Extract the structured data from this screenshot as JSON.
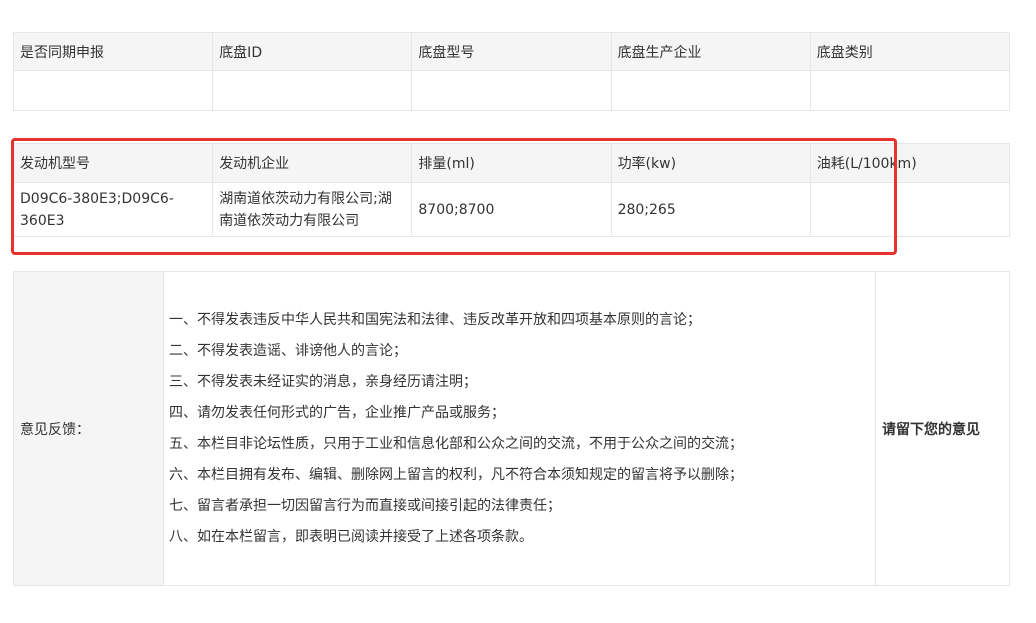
{
  "chassis": {
    "headers": [
      "是否同期申报",
      "底盘ID",
      "底盘型号",
      "底盘生产企业",
      "底盘类别"
    ],
    "values": [
      "",
      "",
      "",
      "",
      ""
    ]
  },
  "engine": {
    "headers": [
      "发动机型号",
      "发动机企业",
      "排量(ml)",
      "功率(kw)",
      "油耗(L/100km)"
    ],
    "values": [
      "D09C6-380E3;D09C6-360E3",
      "湖南道依茨动力有限公司;湖南道依茨动力有限公司",
      "8700;8700",
      "280;265",
      ""
    ]
  },
  "highlight": {
    "color": "#e8322d"
  },
  "feedback": {
    "label": "意见反馈：",
    "rules": [
      "一、不得发表违反中华人民共和国宪法和法律、违反改革开放和四项基本原则的言论；",
      "二、不得发表造谣、诽谤他人的言论；",
      "三、不得发表未经证实的消息，亲身经历请注明；",
      "四、请勿发表任何形式的广告，企业推广产品或服务；",
      "五、本栏目非论坛性质，只用于工业和信息化部和公众之间的交流，不用于公众之间的交流；",
      "六、本栏目拥有发布、编辑、删除网上留言的权利，凡不符合本须知规定的留言将予以删除；",
      "七、留言者承担一切因留言行为而直接或间接引起的法律责任；",
      "八、如在本栏留言，即表明已阅读并接受了上述各项条款。"
    ],
    "cta": "请留下您的意见"
  }
}
